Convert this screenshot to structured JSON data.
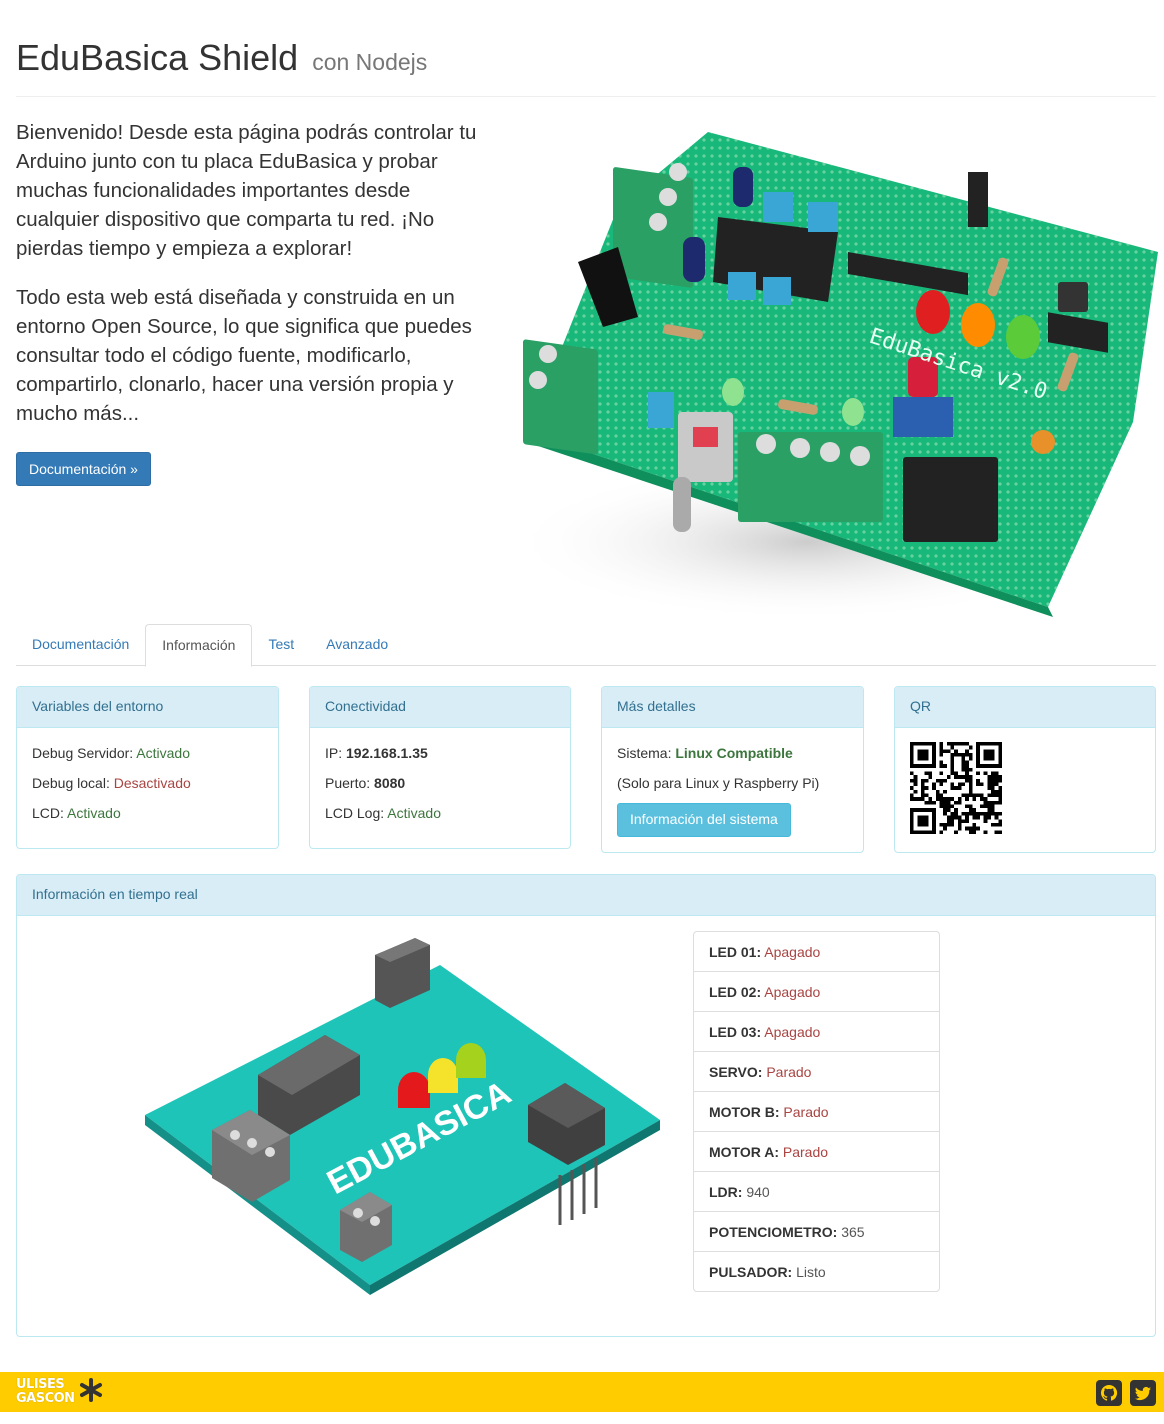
{
  "header": {
    "title": "EduBasica Shield",
    "subtitle": "con Nodejs"
  },
  "intro": {
    "paragraph1": "Bienvenido! Desde esta página podrás controlar tu Arduino junto con tu placa EduBasica y probar muchas funcionalidades importantes desde cualquier dispositivo que comparta tu red. ¡No pierdas tiempo y empieza a explorar!",
    "paragraph2": "Todo esta web está diseñada y construida en un entorno Open Source, lo que significa que puedes consultar todo el código fuente, modificarlo, compartirlo, clonarlo, hacer una versión propia y mucho más...",
    "button": "Documentación »"
  },
  "hero": {
    "board_text": "EduBasica v2.0"
  },
  "tabs": [
    {
      "label": "Documentación",
      "active": false
    },
    {
      "label": "Información",
      "active": true
    },
    {
      "label": "Test",
      "active": false
    },
    {
      "label": "Avanzado",
      "active": false
    }
  ],
  "panels": {
    "env": {
      "title": "Variables del entorno",
      "rows": [
        {
          "label": "Debug Servidor:",
          "value": "Activado"
        },
        {
          "label": "Debug local:",
          "value": "Desactivado"
        },
        {
          "label": "LCD:",
          "value": "Activado"
        }
      ]
    },
    "conn": {
      "title": "Conectividad",
      "rows": [
        {
          "label": "IP:",
          "value": "192.168.1.35"
        },
        {
          "label": "Puerto:",
          "value": "8080"
        },
        {
          "label": "LCD Log:",
          "value": "Activado"
        }
      ]
    },
    "details": {
      "title": "Más detalles",
      "system_label": "Sistema:",
      "system_value": "Linux Compatible",
      "note": "(Solo para Linux y Raspberry Pi)",
      "button": "Información del sistema"
    },
    "qr": {
      "title": "QR"
    },
    "realtime": {
      "title": "Información en tiempo real",
      "illustration_text": "EDUBASICA",
      "items": [
        {
          "label": "LED 01:",
          "value": "Apagado"
        },
        {
          "label": "LED 02:",
          "value": "Apagado"
        },
        {
          "label": "LED 03:",
          "value": "Apagado"
        },
        {
          "label": "SERVO:",
          "value": "Parado"
        },
        {
          "label": "MOTOR B:",
          "value": "Parado"
        },
        {
          "label": "MOTOR A:",
          "value": "Parado"
        },
        {
          "label": "LDR:",
          "value": "940"
        },
        {
          "label": "POTENCIOMETRO:",
          "value": "365"
        },
        {
          "label": "PULSADOR:",
          "value": "Listo"
        }
      ]
    }
  },
  "footer": {
    "logo_line1": "ULISES",
    "logo_line2": "GASCON",
    "icons": [
      "github-icon",
      "twitter-icon"
    ]
  },
  "colors": {
    "primary": "#337ab7",
    "info": "#5bc0de",
    "panel_heading_bg": "#d9edf7",
    "success_text": "#3c763d",
    "danger_text": "#a94442",
    "footer_bg": "#ffcc00",
    "board_teal": "#1fc4b8"
  }
}
